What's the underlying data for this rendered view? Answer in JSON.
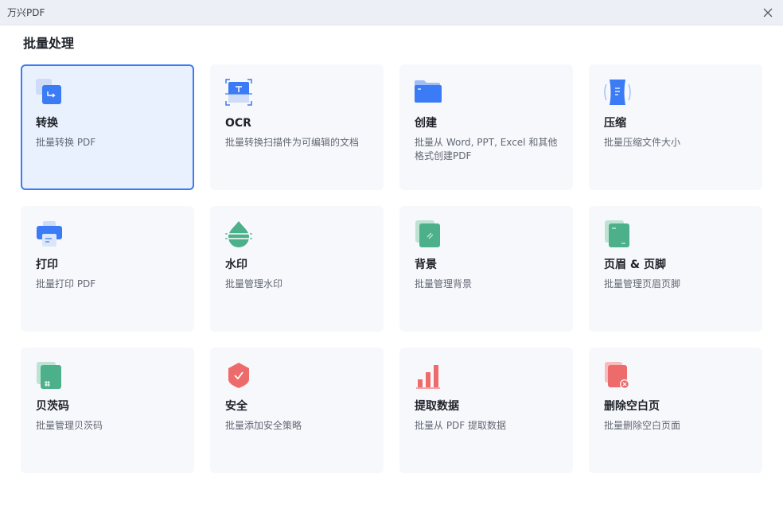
{
  "window": {
    "title": "万兴PDF"
  },
  "page": {
    "section_title": "批量处理"
  },
  "cards": [
    {
      "name": "转换",
      "desc": "批量转换 PDF",
      "icon": "convert-icon"
    },
    {
      "name": "OCR",
      "desc": "批量转换扫描件为可编辑的文档",
      "icon": "ocr-icon"
    },
    {
      "name": "创建",
      "desc": "批量从 Word, PPT, Excel 和其他格式创建PDF",
      "icon": "folder-icon"
    },
    {
      "name": "压缩",
      "desc": "批量压缩文件大小",
      "icon": "compress-icon"
    },
    {
      "name": "打印",
      "desc": "批量打印 PDF",
      "icon": "printer-icon"
    },
    {
      "name": "水印",
      "desc": "批量管理水印",
      "icon": "watermark-icon"
    },
    {
      "name": "背景",
      "desc": "批量管理背景",
      "icon": "background-icon"
    },
    {
      "name": "页眉 & 页脚",
      "desc": "批量管理页眉页脚",
      "icon": "header-footer-icon"
    },
    {
      "name": "贝茨码",
      "desc": "批量管理贝茨码",
      "icon": "bates-number-icon"
    },
    {
      "name": "安全",
      "desc": "批量添加安全策略",
      "icon": "security-shield-icon"
    },
    {
      "name": "提取数据",
      "desc": "批量从 PDF 提取数据",
      "icon": "bar-chart-icon"
    },
    {
      "name": "删除空白页",
      "desc": "批量删除空白页面",
      "icon": "delete-blank-page-icon"
    }
  ],
  "colors": {
    "accent": "#3b7bf5",
    "card_bg": "#f7f8fc",
    "active_bg": "#eaf1fe",
    "green": "#4cb08a",
    "red": "#ee6b6b"
  }
}
